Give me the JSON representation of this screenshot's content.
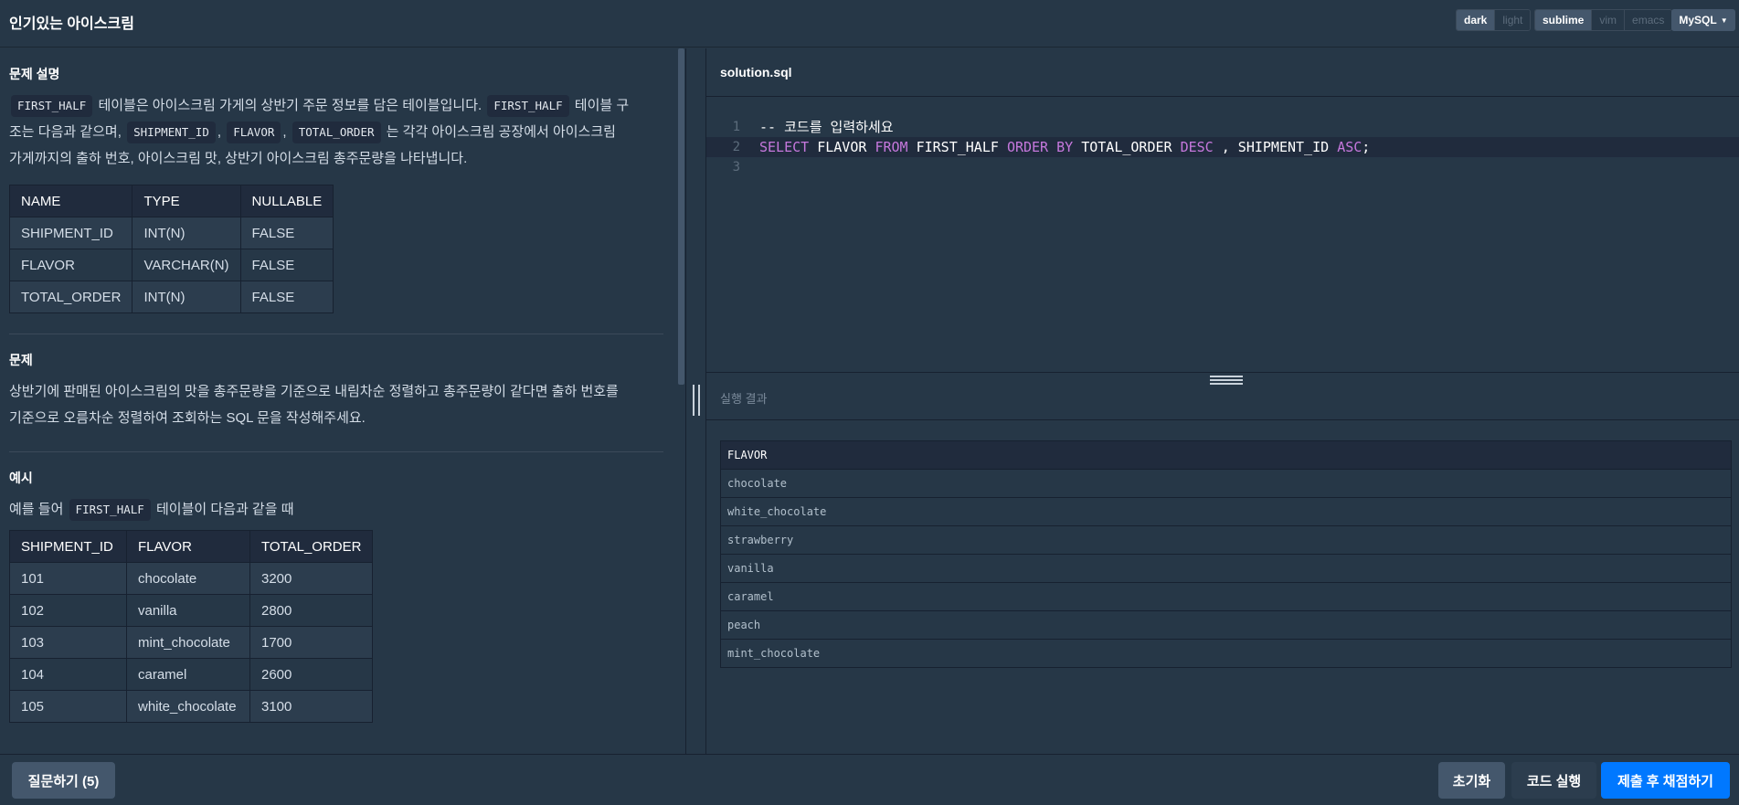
{
  "header": {
    "title": "인기있는 아이스크림",
    "theme_options": [
      "dark",
      "light"
    ],
    "theme_selected": "dark",
    "keymap_options": [
      "sublime",
      "vim",
      "emacs"
    ],
    "keymap_selected": "sublime",
    "language": "MySQL"
  },
  "problem": {
    "description_title": "문제 설명",
    "desc_line1_part1": "테이블은 아이스크림 가게의 상반기 주문 정보를 담은 테이블입니다.",
    "desc_line1_part2": "테이블 구",
    "desc_line2_part1": "조는 다음과 같으며,",
    "desc_line2_part2": "는 각각 아이스크림 공장에서 아이스크림",
    "desc_line3": "가게까지의 출하 번호, 아이스크림 맛, 상반기 아이스크림 총주문량을 나타냅니다.",
    "chips": {
      "first_half": "FIRST_HALF",
      "shipment_id": "SHIPMENT_ID",
      "flavor": "FLAVOR",
      "total_order": "TOTAL_ORDER"
    },
    "comma": ",",
    "schema_table": {
      "headers": [
        "NAME",
        "TYPE",
        "NULLABLE"
      ],
      "rows": [
        [
          "SHIPMENT_ID",
          "INT(N)",
          "FALSE"
        ],
        [
          "FLAVOR",
          "VARCHAR(N)",
          "FALSE"
        ],
        [
          "TOTAL_ORDER",
          "INT(N)",
          "FALSE"
        ]
      ]
    },
    "question_title": "문제",
    "question_line1": "상반기에 판매된 아이스크림의 맛을 총주문량을 기준으로 내림차순 정렬하고 총주문량이 같다면 출하 번호를",
    "question_line2": "기준으로 오름차순 정렬하여 조회하는 SQL 문을 작성해주세요.",
    "example_title": "예시",
    "example_intro_part1": "예를 들어",
    "example_intro_part2": "테이블이 다음과 같을 때",
    "example_table": {
      "headers": [
        "SHIPMENT_ID",
        "FLAVOR",
        "TOTAL_ORDER"
      ],
      "rows": [
        [
          "101",
          "chocolate",
          "3200"
        ],
        [
          "102",
          "vanilla",
          "2800"
        ],
        [
          "103",
          "mint_chocolate",
          "1700"
        ],
        [
          "104",
          "caramel",
          "2600"
        ],
        [
          "105",
          "white_chocolate",
          "3100"
        ]
      ]
    }
  },
  "editor": {
    "filename": "solution.sql",
    "line_numbers": [
      "1",
      "2",
      "3"
    ],
    "line1_comment": "-- 코드를 입력하세요",
    "line2_tokens": {
      "t1": "SELECT",
      "t2": "FLAVOR",
      "t3": "FROM",
      "t4": "FIRST_HALF",
      "t5": "ORDER BY",
      "t6": "TOTAL_ORDER",
      "t7": "DESC",
      "t8": ", SHIPMENT_ID",
      "t9": "ASC",
      "t10": ";"
    }
  },
  "result": {
    "title": "실행 결과",
    "header": "FLAVOR",
    "rows": [
      "chocolate",
      "white_chocolate",
      "strawberry",
      "vanilla",
      "caramel",
      "peach",
      "mint_chocolate"
    ]
  },
  "footer": {
    "ask_label": "질문하기 (5)",
    "reset_label": "초기화",
    "run_label": "코드 실행",
    "submit_label": "제출 후 채점하기"
  },
  "colors": {
    "background": "#263747",
    "dark_cell": "#202b3d",
    "accent_blue": "#0078ff",
    "keyword": "#c678dd",
    "comment": "#e27f5a"
  }
}
